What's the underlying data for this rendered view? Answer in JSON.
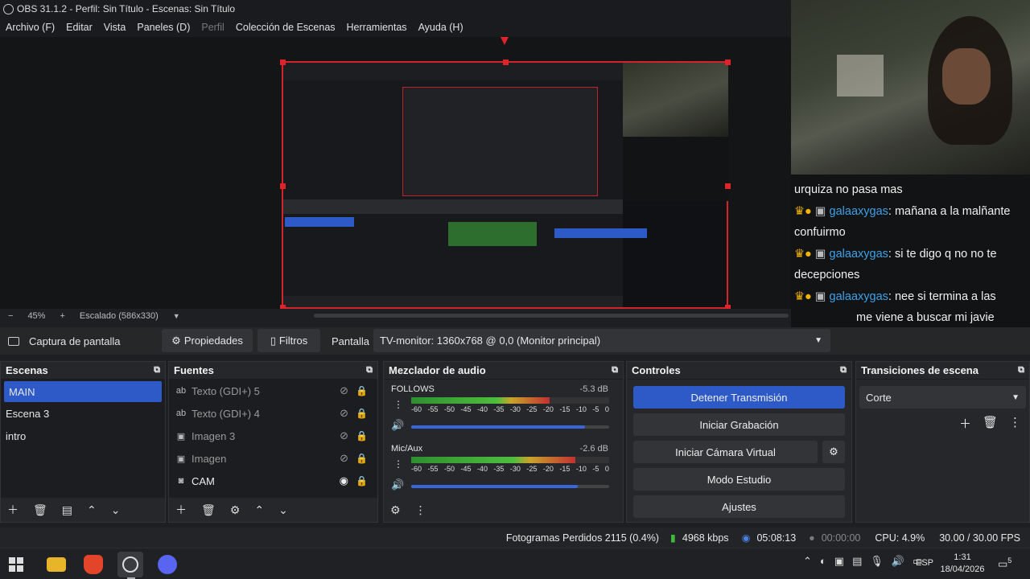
{
  "window": {
    "title": "OBS 31.1.2 - Perfil: Sin Título - Escenas: Sin Título"
  },
  "menu": [
    "Archivo (F)",
    "Editar",
    "Vista",
    "Paneles (D)",
    "Perfil",
    "Colección de Escenas",
    "Herramientas",
    "Ayuda (H)"
  ],
  "zoom": {
    "minus": "−",
    "percent": "45%",
    "plus": "+",
    "scale": "Escalado (586x330)",
    "arrow": "▼"
  },
  "chat": {
    "lines": [
      {
        "user": "",
        "text": "urquiza no pasa mas"
      },
      {
        "user": "galaaxygas",
        "text": ": mañana a la malñante"
      },
      {
        "user": "",
        "text": "confuirmo"
      },
      {
        "user": "galaaxygas",
        "text": ": si te digo q no no te"
      },
      {
        "user": "",
        "text": "decepciones"
      },
      {
        "user": "galaaxygas",
        "text": ": nee si termina a las"
      },
      {
        "user": "",
        "text": "me viene a buscar mi javie"
      }
    ]
  },
  "sourcebar": {
    "source_name": "Captura de pantalla",
    "properties": "Propiedades",
    "filters": "Filtros",
    "display_label": "Pantalla",
    "display_value": "TV-monitor: 1360x768 @ 0,0 (Monitor principal)"
  },
  "scenes": {
    "title": "Escenas",
    "items": [
      "MAIN",
      "Escena 3",
      "intro"
    ],
    "selected": 0
  },
  "sources": {
    "title": "Fuentes",
    "items": [
      {
        "label": "Texto (GDI+) 5",
        "icon": "text-icon",
        "visible": false
      },
      {
        "label": "Texto (GDI+) 4",
        "icon": "text-icon",
        "visible": false
      },
      {
        "label": "Imagen 3",
        "icon": "image-icon",
        "visible": false
      },
      {
        "label": "Imagen",
        "icon": "image-icon",
        "visible": false
      },
      {
        "label": "CAM",
        "icon": "camera-icon",
        "visible": true
      }
    ]
  },
  "mixer": {
    "title": "Mezclador de audio",
    "channels": [
      {
        "name": "FOLLOWS",
        "db": "-5.3 dB",
        "level": 0.7,
        "volume": 0.88
      },
      {
        "name": "Mic/Aux",
        "db": "-2.6 dB",
        "level": 0.83,
        "volume": 0.84
      }
    ],
    "scale": [
      "-60",
      "-55",
      "-50",
      "-45",
      "-40",
      "-35",
      "-30",
      "-25",
      "-20",
      "-15",
      "-10",
      "-5",
      "0"
    ]
  },
  "controls": {
    "title": "Controles",
    "stop_stream": "Detener Transmisión",
    "start_record": "Iniciar Grabación",
    "start_vcam": "Iniciar Cámara Virtual",
    "studio_mode": "Modo Estudio",
    "settings": "Ajustes"
  },
  "transitions": {
    "title": "Transiciones de escena",
    "value": "Corte"
  },
  "status": {
    "dropped": "Fotogramas Perdidos 2115 (0.4%)",
    "bitrate": "4968 kbps",
    "stream_time": "05:08:13",
    "rec_time": "00:00:00",
    "cpu": "CPU: 4.9%",
    "fps": "30.00 / 30.00 FPS"
  },
  "taskbar": {
    "lang": "ESP",
    "time": "1:31",
    "date": "18/04/2026",
    "notif": "5"
  },
  "colors": {
    "accent": "#2e5ac8",
    "selection": "#d5232b",
    "chat_user": "#3fa1e8"
  }
}
